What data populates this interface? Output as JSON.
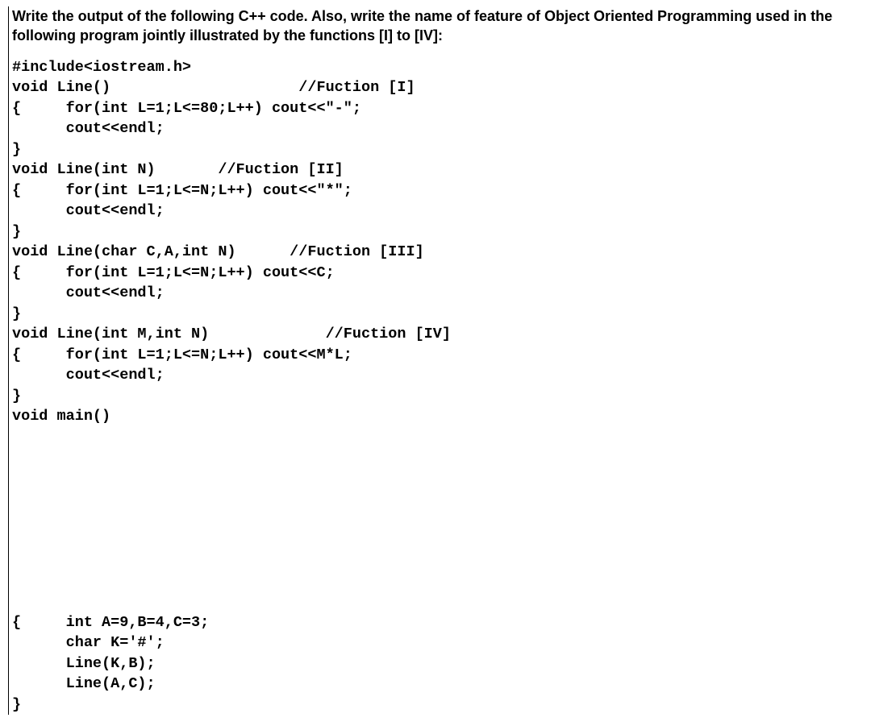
{
  "question": "Write the output of the following C++ code. Also, write the name of feature of Object Oriented Programming used in the following program jointly illustrated by the functions [I] to [IV]:",
  "code_top": "#include<iostream.h>\nvoid Line()                     //Fuction [I]\n{     for(int L=1;L<=80;L++) cout<<\"-\";\n      cout<<endl;\n}\nvoid Line(int N)       //Fuction [II]\n{     for(int L=1;L<=N;L++) cout<<\"*\";\n      cout<<endl;\n}\nvoid Line(char C,A,int N)      //Fuction [III]\n{     for(int L=1;L<=N;L++) cout<<C;\n      cout<<endl;\n}\nvoid Line(int M,int N)             //Fuction [IV]\n{     for(int L=1;L<=N;L++) cout<<M*L;\n      cout<<endl;\n}\nvoid main()",
  "code_bottom": "{     int A=9,B=4,C=3;\n      char K='#';\n      Line(K,B);\n      Line(A,C);\n}"
}
